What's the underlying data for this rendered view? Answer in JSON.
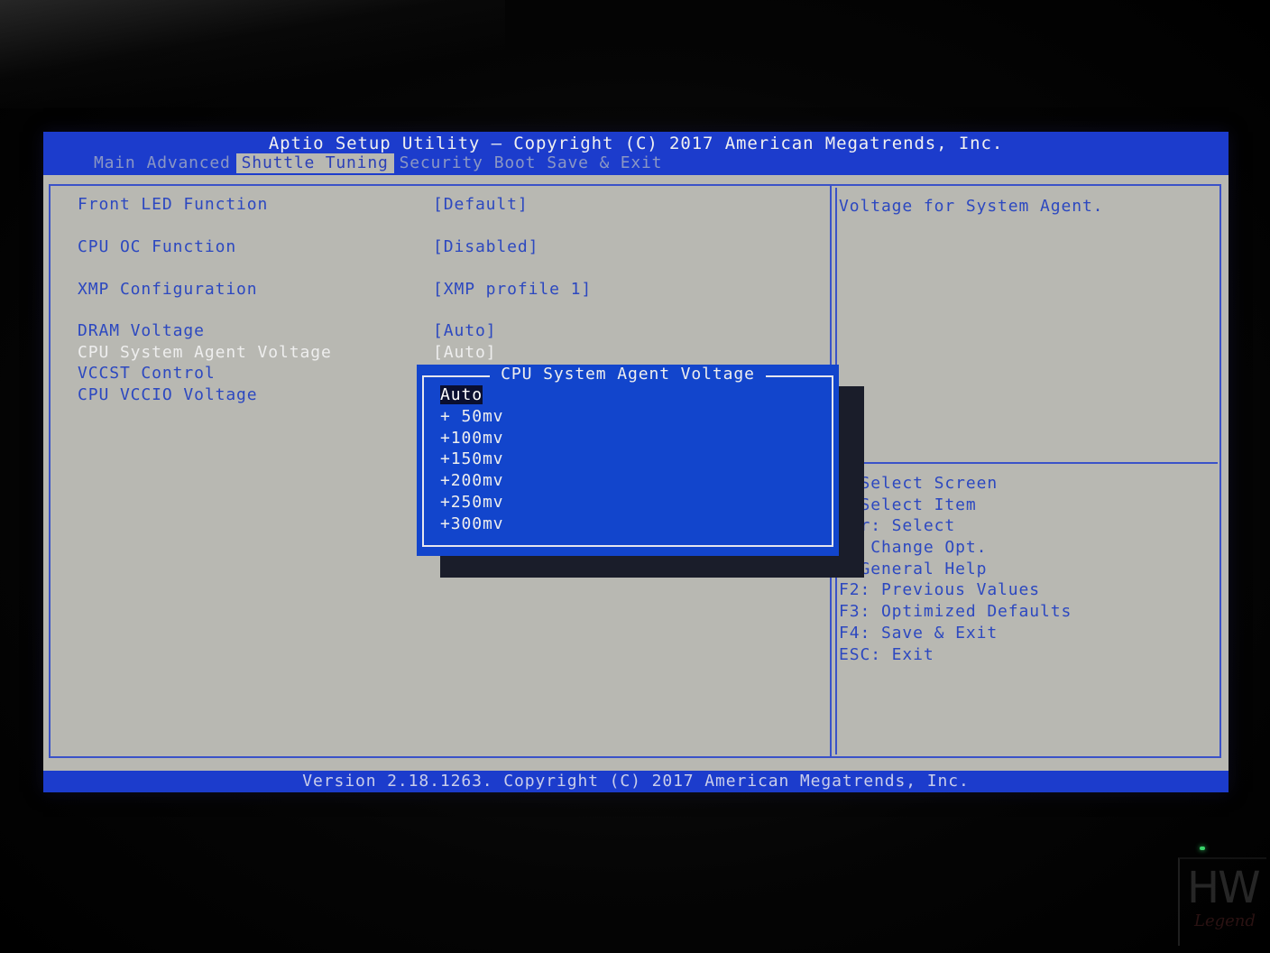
{
  "bios": {
    "title": "Aptio Setup Utility – Copyright (C) 2017 American Megatrends, Inc.",
    "tabs": [
      {
        "label": "Main",
        "active": false
      },
      {
        "label": "Advanced",
        "active": false
      },
      {
        "label": "Shuttle Tuning",
        "active": true
      },
      {
        "label": "Security",
        "active": false
      },
      {
        "label": "Boot",
        "active": false
      },
      {
        "label": "Save & Exit",
        "active": false
      }
    ],
    "settings": [
      {
        "label": "Front LED Function",
        "value": "[Default]"
      },
      {
        "label": "CPU OC Function",
        "value": "[Disabled]"
      },
      {
        "label": "XMP Configuration",
        "value": "[XMP profile 1]"
      },
      {
        "label": "DRAM Voltage",
        "value": "[Auto]"
      },
      {
        "label": "CPU System Agent Voltage",
        "value": "[Auto]"
      },
      {
        "label": "VCCST Control",
        "value": ""
      },
      {
        "label": "CPU VCCIO Voltage",
        "value": ""
      }
    ],
    "help_text": "Voltage for System Agent.",
    "keys": [
      ": Select Screen",
      ": Select Item",
      "ter: Select",
      "-: Change Opt.",
      ": General Help",
      "F2: Previous Values",
      "F3: Optimized Defaults",
      "F4: Save & Exit",
      "ESC: Exit"
    ],
    "popup": {
      "title": "CPU System Agent Voltage",
      "options": [
        "Auto",
        "+ 50mv",
        "+100mv",
        "+150mv",
        "+200mv",
        "+250mv",
        "+300mv"
      ],
      "selected": "Auto"
    },
    "footer": "Version 2.18.1263. Copyright (C) 2017 American Megatrends, Inc."
  },
  "watermark": {
    "logo": "HW",
    "subtitle": "Legend"
  },
  "colors": {
    "bios_blue": "#1c3ccc",
    "bios_gray": "#b8b8b2",
    "text_blue": "#2c48c0",
    "popup_blue": "#1245cc",
    "highlight_text": "#eeeeee"
  }
}
